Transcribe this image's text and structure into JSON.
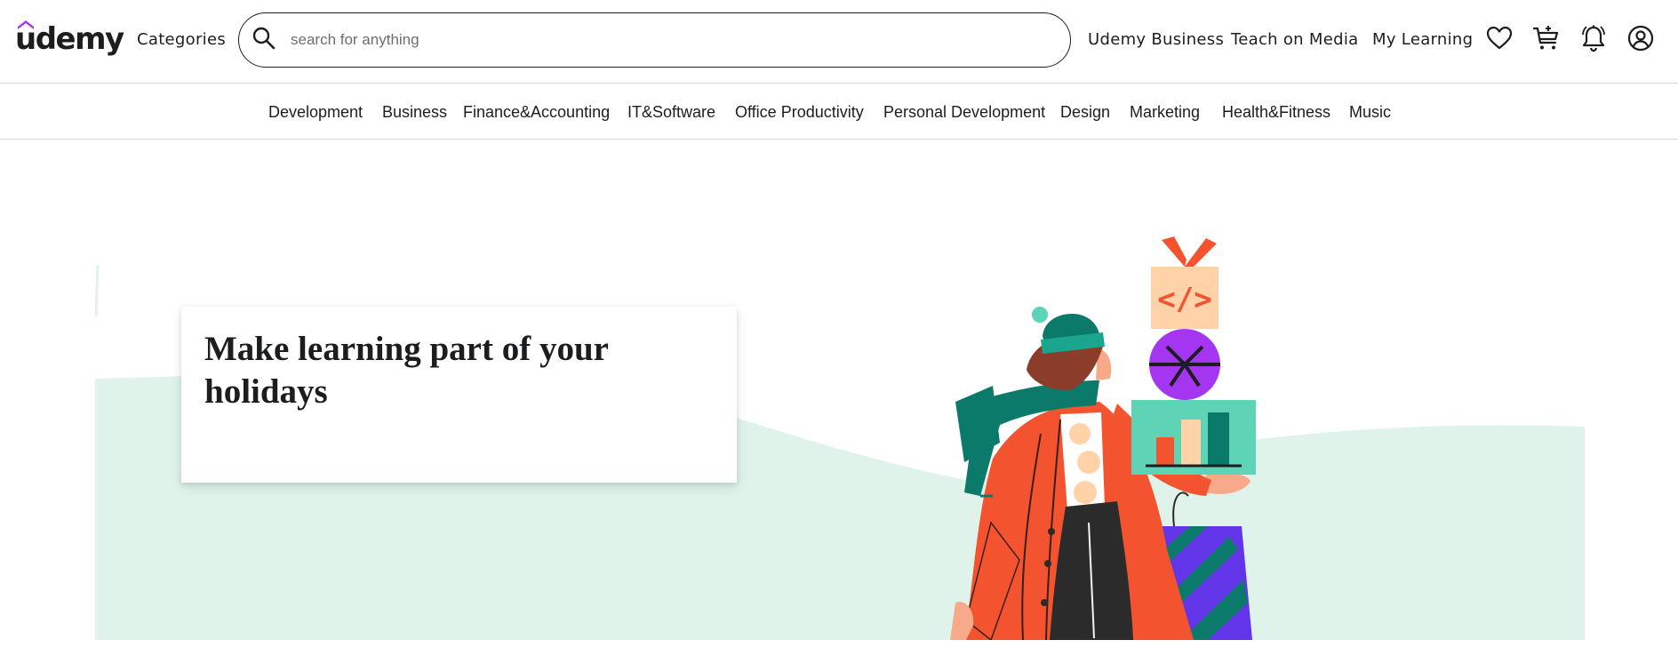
{
  "header": {
    "logo_text": "udemy",
    "categories_label": "Categories",
    "search": {
      "placeholder": "search for anything",
      "value": ""
    },
    "nav": {
      "business_label": "Udemy Business",
      "teach_label": "Teach on Media",
      "learning_label": "My Learning"
    },
    "icons": [
      "heart-icon",
      "cart-icon",
      "bell-icon",
      "user-icon"
    ]
  },
  "category_bar": {
    "items": [
      {
        "label": "Development"
      },
      {
        "label": "Business"
      },
      {
        "label": "Finance&Accounting"
      },
      {
        "label": "IT&Software"
      },
      {
        "label": "Office Productivity"
      },
      {
        "label": "Personal Development"
      },
      {
        "label": "Design"
      },
      {
        "label": "Marketing"
      },
      {
        "label": "Health&Fitness"
      },
      {
        "label": "Music"
      }
    ]
  },
  "hero": {
    "title": "Make learning part of your holidays"
  },
  "colors": {
    "brand_purple": "#a435f0",
    "hero_mint": "#dff3ea",
    "coat_red": "#f4532f",
    "teal": "#0b7a6a",
    "gift_peach": "#ffd2a8",
    "gift_purple": "#a435f0",
    "gift_mint": "#5fd3b5"
  }
}
